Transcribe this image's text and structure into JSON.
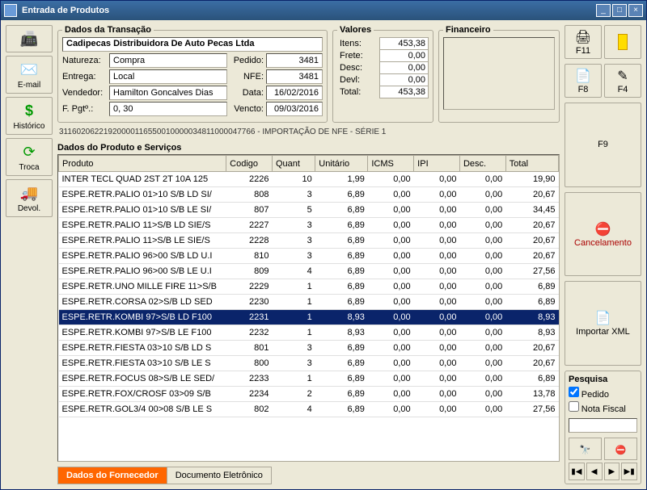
{
  "window": {
    "title": "Entrada de Produtos"
  },
  "leftToolbar": {
    "fax": "",
    "email": "E-mail",
    "historico": "Histórico",
    "troca": "Troca",
    "devol": "Devol."
  },
  "transacao": {
    "legend": "Dados da Transação",
    "company": "Cadipecas Distribuidora De Auto Pecas Ltda",
    "labels": {
      "natureza": "Natureza:",
      "entrega": "Entrega:",
      "vendedor": "Vendedor:",
      "fpgto": "F. Pgtº.:",
      "pedido": "Pedido:",
      "nfe": "NFE:",
      "data": "Data:",
      "vencto": "Vencto:"
    },
    "natureza": "Compra",
    "entrega": "Local",
    "vendedor": "Hamilton Goncalves Dias Ju",
    "fpgto": "0, 30",
    "pedido": "3481",
    "nfe": "3481",
    "data": "16/02/2016",
    "vencto": "09/03/2016"
  },
  "valores": {
    "legend": "Valores",
    "labels": {
      "itens": "Itens:",
      "frete": "Frete:",
      "desc": "Desc:",
      "devl": "Devl:",
      "total": "Total:"
    },
    "itens": "453,38",
    "frete": "0,00",
    "desc": "0,00",
    "devl": "0,00",
    "total": "453,38"
  },
  "financeiro": {
    "legend": "Financeiro"
  },
  "import_line": "31160206221920000116550010000034811000047766 - IMPORTAÇÃO DE NFE - SÉRIE 1",
  "grid": {
    "title": "Dados do Produto e Serviços",
    "headers": {
      "produto": "Produto",
      "codigo": "Codigo",
      "quant": "Quant",
      "unitario": "Unitário",
      "icms": "ICMS",
      "ipi": "IPI",
      "desc": "Desc.",
      "total": "Total"
    },
    "selectedIndex": 9,
    "rows": [
      {
        "produto": "INTER TECL QUAD 2ST 2T 10A 125",
        "codigo": "2226",
        "quant": "10",
        "unitario": "1,99",
        "icms": "0,00",
        "ipi": "0,00",
        "desc": "0,00",
        "total": "19,90"
      },
      {
        "produto": "ESPE.RETR.PALIO 01>10 S/B LD SI/",
        "codigo": "808",
        "quant": "3",
        "unitario": "6,89",
        "icms": "0,00",
        "ipi": "0,00",
        "desc": "0,00",
        "total": "20,67"
      },
      {
        "produto": "ESPE.RETR.PALIO 01>10 S/B LE SI/",
        "codigo": "807",
        "quant": "5",
        "unitario": "6,89",
        "icms": "0,00",
        "ipi": "0,00",
        "desc": "0,00",
        "total": "34,45"
      },
      {
        "produto": "ESPE.RETR.PALIO 11>S/B LD SIE/S",
        "codigo": "2227",
        "quant": "3",
        "unitario": "6,89",
        "icms": "0,00",
        "ipi": "0,00",
        "desc": "0,00",
        "total": "20,67"
      },
      {
        "produto": "ESPE.RETR.PALIO 11>S/B LE SIE/S",
        "codigo": "2228",
        "quant": "3",
        "unitario": "6,89",
        "icms": "0,00",
        "ipi": "0,00",
        "desc": "0,00",
        "total": "20,67"
      },
      {
        "produto": "ESPE.RETR.PALIO 96>00 S/B LD U.I",
        "codigo": "810",
        "quant": "3",
        "unitario": "6,89",
        "icms": "0,00",
        "ipi": "0,00",
        "desc": "0,00",
        "total": "20,67"
      },
      {
        "produto": "ESPE.RETR.PALIO 96>00 S/B LE U.I",
        "codigo": "809",
        "quant": "4",
        "unitario": "6,89",
        "icms": "0,00",
        "ipi": "0,00",
        "desc": "0,00",
        "total": "27,56"
      },
      {
        "produto": "ESPE.RETR.UNO MILLE FIRE 11>S/B",
        "codigo": "2229",
        "quant": "1",
        "unitario": "6,89",
        "icms": "0,00",
        "ipi": "0,00",
        "desc": "0,00",
        "total": "6,89"
      },
      {
        "produto": "ESPE.RETR.CORSA 02>S/B LD SED",
        "codigo": "2230",
        "quant": "1",
        "unitario": "6,89",
        "icms": "0,00",
        "ipi": "0,00",
        "desc": "0,00",
        "total": "6,89"
      },
      {
        "produto": "ESPE.RETR.KOMBI 97>S/B LD F100",
        "codigo": "2231",
        "quant": "1",
        "unitario": "8,93",
        "icms": "0,00",
        "ipi": "0,00",
        "desc": "0,00",
        "total": "8,93"
      },
      {
        "produto": "ESPE.RETR.KOMBI 97>S/B LE F100",
        "codigo": "2232",
        "quant": "1",
        "unitario": "8,93",
        "icms": "0,00",
        "ipi": "0,00",
        "desc": "0,00",
        "total": "8,93"
      },
      {
        "produto": "ESPE.RETR.FIESTA 03>10 S/B LD S",
        "codigo": "801",
        "quant": "3",
        "unitario": "6,89",
        "icms": "0,00",
        "ipi": "0,00",
        "desc": "0,00",
        "total": "20,67"
      },
      {
        "produto": "ESPE.RETR.FIESTA 03>10 S/B LE S",
        "codigo": "800",
        "quant": "3",
        "unitario": "6,89",
        "icms": "0,00",
        "ipi": "0,00",
        "desc": "0,00",
        "total": "20,67"
      },
      {
        "produto": "ESPE.RETR.FOCUS 08>S/B LE SED/",
        "codigo": "2233",
        "quant": "1",
        "unitario": "6,89",
        "icms": "0,00",
        "ipi": "0,00",
        "desc": "0,00",
        "total": "6,89"
      },
      {
        "produto": "ESPE.RETR.FOX/CROSF 03>09 S/B",
        "codigo": "2234",
        "quant": "2",
        "unitario": "6,89",
        "icms": "0,00",
        "ipi": "0,00",
        "desc": "0,00",
        "total": "13,78"
      },
      {
        "produto": "ESPE.RETR.GOL3/4 00>08 S/B LE S",
        "codigo": "802",
        "quant": "4",
        "unitario": "6,89",
        "icms": "0,00",
        "ipi": "0,00",
        "desc": "0,00",
        "total": "27,56"
      }
    ]
  },
  "tabs": {
    "fornecedor": "Dados do Fornecedor",
    "doc": "Documento Eletrônico"
  },
  "right": {
    "f11": "F11",
    "f8": "F8",
    "f4": "F4",
    "f9": "F9",
    "cancel": "Cancelamento",
    "import": "Importar XML",
    "pesquisa": {
      "legend": "Pesquisa",
      "pedido": "Pedido",
      "nota": "Nota Fiscal"
    }
  }
}
